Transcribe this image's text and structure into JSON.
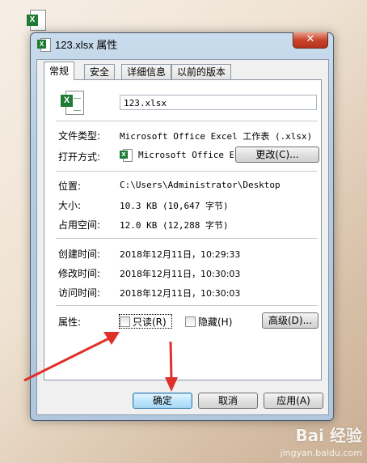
{
  "window": {
    "title": "123.xlsx 属性",
    "close_glyph": "✕"
  },
  "tabs": [
    {
      "label": "常规",
      "active": true
    },
    {
      "label": "安全",
      "active": false
    },
    {
      "label": "详细信息",
      "active": false
    },
    {
      "label": "以前的版本",
      "active": false
    }
  ],
  "general": {
    "file_name": "123.xlsx",
    "file_type_label": "文件类型:",
    "file_type_value": "Microsoft Office Excel 工作表 (.xlsx)",
    "opens_with_label": "打开方式:",
    "opens_with_value": "Microsoft Office Ex",
    "change_button": "更改(C)...",
    "location_label": "位置:",
    "location_value": "C:\\Users\\Administrator\\Desktop",
    "size_label": "大小:",
    "size_value": "10.3 KB (10,647 字节)",
    "size_on_disk_label": "占用空间:",
    "size_on_disk_value": "12.0 KB (12,288 字节)",
    "created_label": "创建时间:",
    "created_value": "2018年12月11日，10:29:33",
    "modified_label": "修改时间:",
    "modified_value": "2018年12月11日，10:30:03",
    "accessed_label": "访问时间:",
    "accessed_value": "2018年12月11日，10:30:03",
    "attributes_label": "属性:",
    "readonly_label": "只读(R)",
    "readonly_checked": false,
    "hidden_label": "隐藏(H)",
    "hidden_checked": false,
    "advanced_button": "高级(D)..."
  },
  "footer": {
    "ok_button": "确定",
    "cancel_button": "取消",
    "apply_button": "应用(A)"
  },
  "annotation_color": "#e0302a",
  "watermark": {
    "logo_text": "Bai 经验",
    "url": "jingyan.baidu.com"
  },
  "icons": {
    "desktop_file": "excel-file-icon",
    "title": "excel-file-icon",
    "file": "excel-file-icon",
    "opens_with": "excel-app-icon"
  }
}
